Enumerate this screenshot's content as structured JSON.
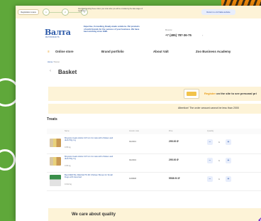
{
  "colors": {
    "accent": "#e89a14",
    "brand": "#2a58a8",
    "background": "#5fa83a",
    "cream": "#fdf3d7"
  },
  "top_strip": {
    "register_button": "Registration review",
    "steps": [
      "1",
      "2",
      "3"
    ],
    "text": "Attention! Sending these orders your order after you will be considering the data stages of registration",
    "return_button": "Return to old Valta website"
  },
  "header": {
    "logo": "Валта",
    "logo_sub": "PET PRODUCTS",
    "tagline": "Expertise, Consulting, Ready-made solutions. Pet products of world brands for the success of your business. We have been working since 1996.",
    "phone_label": "Moscow",
    "phone": "+7 (495) 787-36-75"
  },
  "menu": [
    "Online store",
    "Brand portfolio",
    "About Valt",
    "Zoo Business Academy"
  ],
  "breadcrumbs": {
    "home": "Home",
    "separator": "/",
    "current": "Basket"
  },
  "page_title": "Basket",
  "cashback": {
    "link": "Register",
    "text": "on the site to see personal pri"
  },
  "attention": "Attention! The order amount cannot be less than 2000",
  "section_title": "Treats",
  "table": {
    "headers": [
      "Name",
      "Vendor code",
      "Price",
      "Quantity"
    ],
    "rows": [
      {
        "name": "Mnyams treats sticks 13.5 cm for cats with chicken and duck 50g 4 g",
        "weight": "0.05 kg",
        "code": "912301",
        "price": "295.00 ₽",
        "qty": "1"
      },
      {
        "name": "Mnyams treats sticks 13.5 cm for cats with chicken and duck 50g 4 g",
        "weight": "0.05 kg",
        "code": "912304",
        "price": "295.00 ₽",
        "qty": "1"
      },
      {
        "name": "Best DENTAL DELIGHTS 3D Chicken Bones for Small Dogs with Assorted",
        "weight": "0.012 kg",
        "code": "106808",
        "price": "5538.91 ₽",
        "qty": "1"
      }
    ]
  },
  "quality": "We care about quality"
}
